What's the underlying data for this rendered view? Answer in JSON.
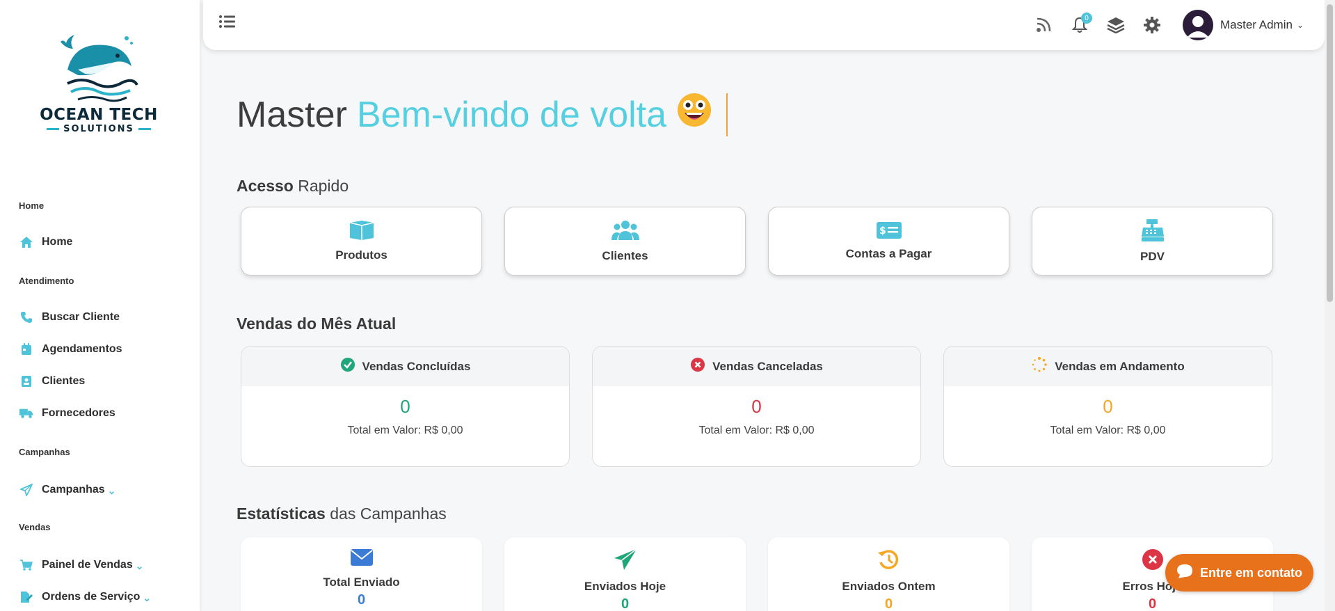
{
  "brand": {
    "line1": "OCEAN TECH",
    "line2": "SOLUTIONS"
  },
  "sidebar": {
    "sections": [
      {
        "label": "Home"
      },
      {
        "label": "Atendimento"
      },
      {
        "label": "Campanhas"
      },
      {
        "label": "Vendas"
      }
    ],
    "items": [
      {
        "label": "Home",
        "icon": "home-icon"
      },
      {
        "label": "Buscar Cliente",
        "icon": "phone-icon"
      },
      {
        "label": "Agendamentos",
        "icon": "calendar-icon"
      },
      {
        "label": "Clientes",
        "icon": "contact-card-icon"
      },
      {
        "label": "Fornecedores",
        "icon": "truck-icon"
      },
      {
        "label": "Campanhas",
        "icon": "paper-plane-icon"
      },
      {
        "label": "Painel de Vendas",
        "icon": "cart-icon"
      },
      {
        "label": "Ordens de Serviço",
        "icon": "document-edit-icon"
      }
    ]
  },
  "topbar": {
    "notification_count": "0",
    "user_name": "Master Admin"
  },
  "welcome": {
    "name": "Master",
    "message": "Bem-vindo de volta"
  },
  "quick_access": {
    "title_bold": "Acesso",
    "title_rest": " Rapido",
    "items": [
      {
        "label": "Produtos",
        "icon": "box-icon"
      },
      {
        "label": "Clientes",
        "icon": "users-icon"
      },
      {
        "label": "Contas a Pagar",
        "icon": "money-bill-icon"
      },
      {
        "label": "PDV",
        "icon": "cash-register-icon"
      }
    ]
  },
  "sales": {
    "title": "Vendas do Mês Atual",
    "cards": [
      {
        "label": "Vendas Concluídas",
        "value": "0",
        "total": "Total em Valor: R$ 0,00",
        "color": "#20a67a"
      },
      {
        "label": "Vendas Canceladas",
        "value": "0",
        "total": "Total em Valor: R$ 0,00",
        "color": "#dc3545"
      },
      {
        "label": "Vendas em Andamento",
        "value": "0",
        "total": "Total em Valor: R$ 0,00",
        "color": "#f5a623"
      }
    ]
  },
  "campaigns": {
    "title_bold": "Estatísticas",
    "title_rest": " das Campanhas",
    "cards": [
      {
        "label": "Total Enviado",
        "value": "0",
        "color": "#3a7bd5"
      },
      {
        "label": "Enviados Hoje",
        "value": "0",
        "color": "#20a67a"
      },
      {
        "label": "Enviados Ontem",
        "value": "0",
        "color": "#f5a623"
      },
      {
        "label": "Erros Hoje",
        "value": "0",
        "color": "#dc3545"
      }
    ]
  },
  "contact_button": {
    "label": "Entre em contato"
  }
}
